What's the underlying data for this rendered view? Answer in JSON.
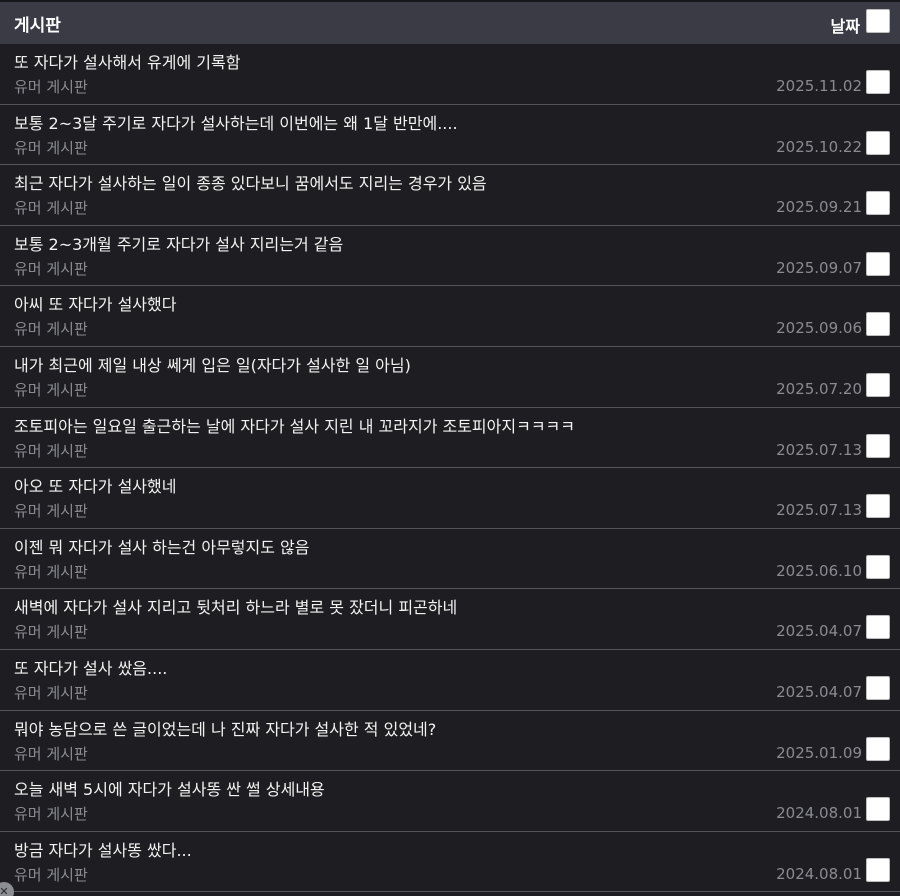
{
  "header": {
    "title": "게시판",
    "date_label": "날짜"
  },
  "rows": [
    {
      "title": "또 자다가 설사해서 유게에 기록함",
      "category": "유머 게시판",
      "date": "2025.11.02"
    },
    {
      "title": "보통 2~3달 주기로 자다가 설사하는데 이번에는 왜 1달 반만에....",
      "category": "유머 게시판",
      "date": "2025.10.22"
    },
    {
      "title": "최근 자다가 설사하는 일이 종종 있다보니 꿈에서도 지리는 경우가 있음",
      "category": "유머 게시판",
      "date": "2025.09.21"
    },
    {
      "title": "보통 2~3개월 주기로 자다가 설사 지리는거 같음",
      "category": "유머 게시판",
      "date": "2025.09.07"
    },
    {
      "title": "아씨 또 자다가 설사했다",
      "category": "유머 게시판",
      "date": "2025.09.06"
    },
    {
      "title": "내가 최근에 제일 내상 쎄게 입은 일(자다가 설사한 일 아님)",
      "category": "유머 게시판",
      "date": "2025.07.20"
    },
    {
      "title": "조토피아는 일요일 출근하는 날에 자다가 설사 지린 내 꼬라지가 조토피아지ㅋㅋㅋㅋ",
      "category": "유머 게시판",
      "date": "2025.07.13"
    },
    {
      "title": "아오 또 자다가 설사했네",
      "category": "유머 게시판",
      "date": "2025.07.13"
    },
    {
      "title": "이젠 뭐 자다가 설사 하는건 아무렇지도 않음",
      "category": "유머 게시판",
      "date": "2025.06.10"
    },
    {
      "title": "새벽에 자다가 설사 지리고 뒷처리 하느라 별로 못 잤더니 피곤하네",
      "category": "유머 게시판",
      "date": "2025.04.07"
    },
    {
      "title": "또 자다가 설사 쌌음....",
      "category": "유머 게시판",
      "date": "2025.04.07"
    },
    {
      "title": "뭐야 농담으로 쓴 글이었는데 나 진짜 자다가 설사한 적 있었네?",
      "category": "유머 게시판",
      "date": "2025.01.09"
    },
    {
      "title": "오늘 새벽 5시에 자다가 설사똥 싼 썰 상세내용",
      "category": "유머 게시판",
      "date": "2024.08.01"
    },
    {
      "title": "방금 자다가 설사똥 쌌다...",
      "category": "유머 게시판",
      "date": "2024.08.01"
    }
  ],
  "corner_icon": "close-icon"
}
